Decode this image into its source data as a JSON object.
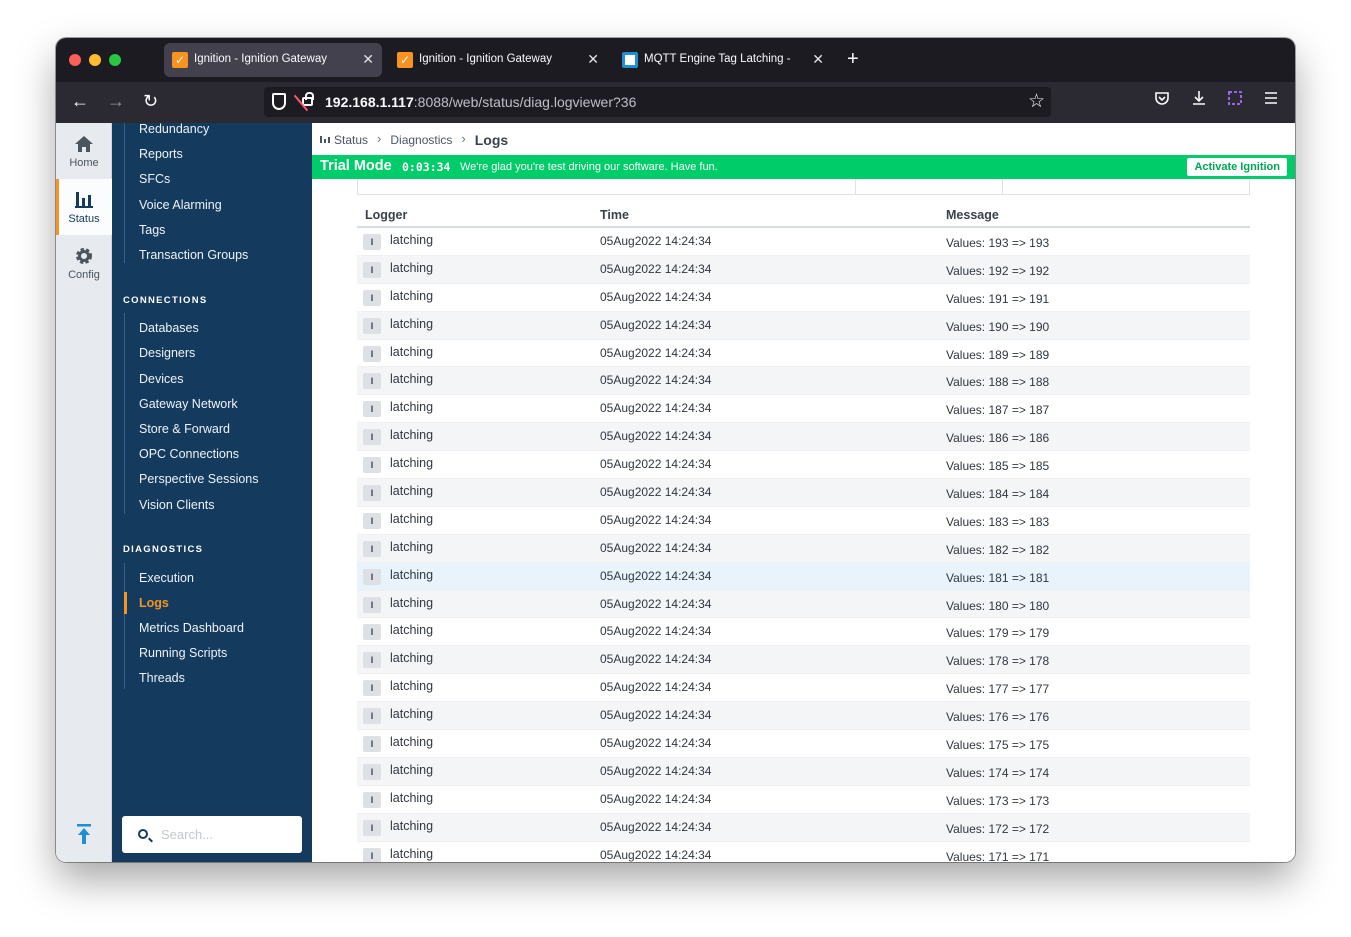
{
  "browser": {
    "tabs": [
      {
        "title": "Ignition - Ignition Gateway",
        "active": true,
        "favicon": "ignition-icon"
      },
      {
        "title": "Ignition - Ignition Gateway",
        "active": false,
        "favicon": "ignition-icon"
      },
      {
        "title": "MQTT Engine Tag Latching - MQ",
        "active": false,
        "favicon": "mqtt-icon"
      }
    ],
    "close_glyph": "✕",
    "new_tab_glyph": "+",
    "url_host": "192.168.1.117",
    "url_rest": ":8088/web/status/diag.logviewer?36"
  },
  "rail": [
    {
      "label": "Home",
      "icon": "home-icon"
    },
    {
      "label": "Status",
      "icon": "status-chart-icon",
      "active": true
    },
    {
      "label": "Config",
      "icon": "gear-icon"
    }
  ],
  "sidebar": {
    "top_items": [
      "Redundancy",
      "Reports",
      "SFCs",
      "Voice Alarming",
      "Tags",
      "Transaction Groups"
    ],
    "connections_heading": "CONNECTIONS",
    "connections_items": [
      "Databases",
      "Designers",
      "Devices",
      "Gateway Network",
      "Store & Forward",
      "OPC Connections",
      "Perspective Sessions",
      "Vision Clients"
    ],
    "diagnostics_heading": "DIAGNOSTICS",
    "diagnostics_items": [
      "Execution",
      "Logs",
      "Metrics Dashboard",
      "Running Scripts",
      "Threads"
    ],
    "active_item": "Logs",
    "search_placeholder": "Search..."
  },
  "breadcrumb": {
    "status": "Status",
    "diagnostics": "Diagnostics",
    "current": "Logs",
    "separator": "›"
  },
  "trial": {
    "title": "Trial Mode",
    "time": "0:03:34",
    "message": "We're glad you're test driving our software. Have fun.",
    "button": "Activate Ignition"
  },
  "log_table": {
    "headers": {
      "logger": "Logger",
      "time": "Time",
      "message": "Message"
    },
    "rows": [
      {
        "level": "I",
        "logger": "latching",
        "time": "05Aug2022 14:24:34",
        "message": "Values: 193 => 193"
      },
      {
        "level": "I",
        "logger": "latching",
        "time": "05Aug2022 14:24:34",
        "message": "Values: 192 => 192"
      },
      {
        "level": "I",
        "logger": "latching",
        "time": "05Aug2022 14:24:34",
        "message": "Values: 191 => 191"
      },
      {
        "level": "I",
        "logger": "latching",
        "time": "05Aug2022 14:24:34",
        "message": "Values: 190 => 190"
      },
      {
        "level": "I",
        "logger": "latching",
        "time": "05Aug2022 14:24:34",
        "message": "Values: 189 => 189"
      },
      {
        "level": "I",
        "logger": "latching",
        "time": "05Aug2022 14:24:34",
        "message": "Values: 188 => 188"
      },
      {
        "level": "I",
        "logger": "latching",
        "time": "05Aug2022 14:24:34",
        "message": "Values: 187 => 187"
      },
      {
        "level": "I",
        "logger": "latching",
        "time": "05Aug2022 14:24:34",
        "message": "Values: 186 => 186"
      },
      {
        "level": "I",
        "logger": "latching",
        "time": "05Aug2022 14:24:34",
        "message": "Values: 185 => 185"
      },
      {
        "level": "I",
        "logger": "latching",
        "time": "05Aug2022 14:24:34",
        "message": "Values: 184 => 184"
      },
      {
        "level": "I",
        "logger": "latching",
        "time": "05Aug2022 14:24:34",
        "message": "Values: 183 => 183"
      },
      {
        "level": "I",
        "logger": "latching",
        "time": "05Aug2022 14:24:34",
        "message": "Values: 182 => 182"
      },
      {
        "level": "I",
        "logger": "latching",
        "time": "05Aug2022 14:24:34",
        "message": "Values: 181 => 181",
        "hover": true
      },
      {
        "level": "I",
        "logger": "latching",
        "time": "05Aug2022 14:24:34",
        "message": "Values: 180 => 180"
      },
      {
        "level": "I",
        "logger": "latching",
        "time": "05Aug2022 14:24:34",
        "message": "Values: 179 => 179"
      },
      {
        "level": "I",
        "logger": "latching",
        "time": "05Aug2022 14:24:34",
        "message": "Values: 178 => 178"
      },
      {
        "level": "I",
        "logger": "latching",
        "time": "05Aug2022 14:24:34",
        "message": "Values: 177 => 177"
      },
      {
        "level": "I",
        "logger": "latching",
        "time": "05Aug2022 14:24:34",
        "message": "Values: 176 => 176"
      },
      {
        "level": "I",
        "logger": "latching",
        "time": "05Aug2022 14:24:34",
        "message": "Values: 175 => 175"
      },
      {
        "level": "I",
        "logger": "latching",
        "time": "05Aug2022 14:24:34",
        "message": "Values: 174 => 174"
      },
      {
        "level": "I",
        "logger": "latching",
        "time": "05Aug2022 14:24:34",
        "message": "Values: 173 => 173"
      },
      {
        "level": "I",
        "logger": "latching",
        "time": "05Aug2022 14:24:34",
        "message": "Values: 172 => 172"
      },
      {
        "level": "I",
        "logger": "latching",
        "time": "05Aug2022 14:24:34",
        "message": "Values: 171 => 171"
      }
    ]
  },
  "colors": {
    "sidebar_bg": "#143a5e",
    "accent_orange": "#f7931e",
    "trial_green": "#00cc6a"
  }
}
